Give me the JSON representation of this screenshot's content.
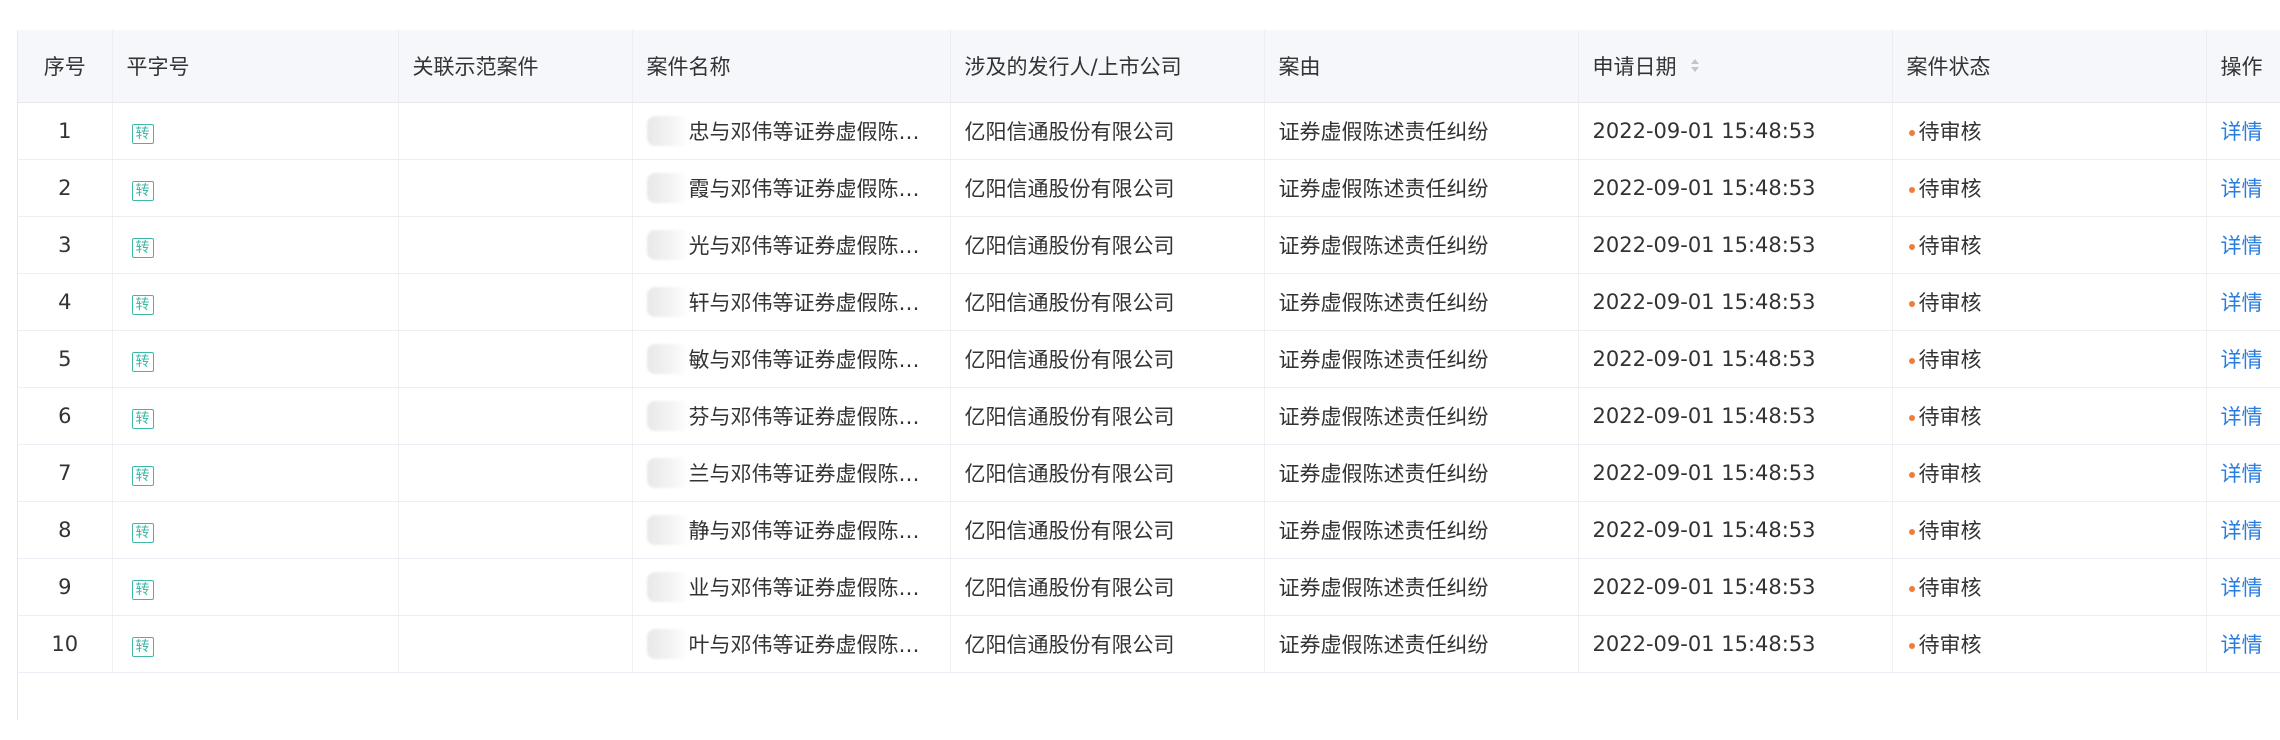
{
  "table": {
    "columns": {
      "index": "序号",
      "ping_zi_hao": "平字号",
      "related_case": "关联示范案件",
      "case_name": "案件名称",
      "issuer": "涉及的发行人/上市公司",
      "cause": "案由",
      "apply_date": "申请日期",
      "status": "案件状态",
      "action": "操作"
    },
    "rows": [
      {
        "index": "1",
        "tag": "转",
        "related": "",
        "case_name": "忠与邓伟等证券虚假陈述…",
        "issuer": "亿阳信通股份有限公司",
        "cause": "证券虚假陈述责任纠纷",
        "date": "2022-09-01 15:48:53",
        "status": "待审核",
        "action": "详情"
      },
      {
        "index": "2",
        "tag": "转",
        "related": "",
        "case_name": "霞与邓伟等证券虚假陈述…",
        "issuer": "亿阳信通股份有限公司",
        "cause": "证券虚假陈述责任纠纷",
        "date": "2022-09-01 15:48:53",
        "status": "待审核",
        "action": "详情"
      },
      {
        "index": "3",
        "tag": "转",
        "related": "",
        "case_name": "光与邓伟等证券虚假陈述…",
        "issuer": "亿阳信通股份有限公司",
        "cause": "证券虚假陈述责任纠纷",
        "date": "2022-09-01 15:48:53",
        "status": "待审核",
        "action": "详情"
      },
      {
        "index": "4",
        "tag": "转",
        "related": "",
        "case_name": "轩与邓伟等证券虚假陈述…",
        "issuer": "亿阳信通股份有限公司",
        "cause": "证券虚假陈述责任纠纷",
        "date": "2022-09-01 15:48:53",
        "status": "待审核",
        "action": "详情"
      },
      {
        "index": "5",
        "tag": "转",
        "related": "",
        "case_name": "敏与邓伟等证券虚假陈述…",
        "issuer": "亿阳信通股份有限公司",
        "cause": "证券虚假陈述责任纠纷",
        "date": "2022-09-01 15:48:53",
        "status": "待审核",
        "action": "详情"
      },
      {
        "index": "6",
        "tag": "转",
        "related": "",
        "case_name": "芬与邓伟等证券虚假陈述…",
        "issuer": "亿阳信通股份有限公司",
        "cause": "证券虚假陈述责任纠纷",
        "date": "2022-09-01 15:48:53",
        "status": "待审核",
        "action": "详情"
      },
      {
        "index": "7",
        "tag": "转",
        "related": "",
        "case_name": "兰与邓伟等证券虚假陈述…",
        "issuer": "亿阳信通股份有限公司",
        "cause": "证券虚假陈述责任纠纷",
        "date": "2022-09-01 15:48:53",
        "status": "待审核",
        "action": "详情"
      },
      {
        "index": "8",
        "tag": "转",
        "related": "",
        "case_name": "静与邓伟等证券虚假陈述责…",
        "issuer": "亿阳信通股份有限公司",
        "cause": "证券虚假陈述责任纠纷",
        "date": "2022-09-01 15:48:53",
        "status": "待审核",
        "action": "详情"
      },
      {
        "index": "9",
        "tag": "转",
        "related": "",
        "case_name": "业与邓伟等证券虚假陈述…",
        "issuer": "亿阳信通股份有限公司",
        "cause": "证券虚假陈述责任纠纷",
        "date": "2022-09-01 15:48:53",
        "status": "待审核",
        "action": "详情"
      },
      {
        "index": "10",
        "tag": "转",
        "related": "",
        "case_name": "叶与邓伟等证券虚假陈述…",
        "issuer": "亿阳信通股份有限公司",
        "cause": "证券虚假陈述责任纠纷",
        "date": "2022-09-01 15:48:53",
        "status": "待审核",
        "action": "详情"
      }
    ]
  },
  "colors": {
    "tag": "#3fb8a6",
    "status_dot": "#f07c3c",
    "link": "#2a7ee0",
    "header_bg": "#f5f7fa"
  },
  "icons": {
    "sort": "sort-caret-icon"
  }
}
